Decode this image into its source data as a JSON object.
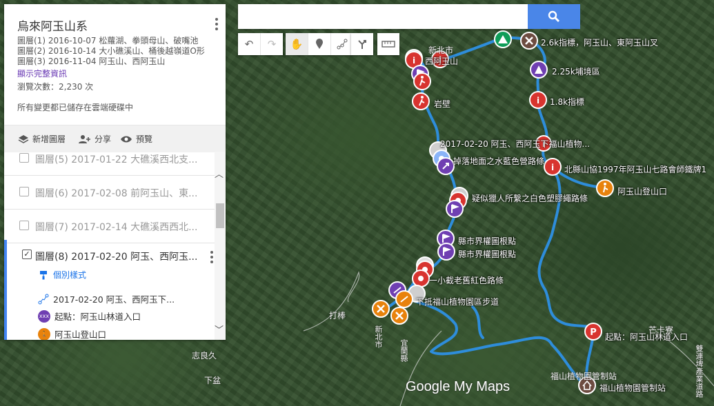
{
  "panel": {
    "title": "烏來阿玉山系",
    "desc_lines": [
      "圖層(1) 2016-10-07 松蘿湖、拳頭母山、破嘴池",
      "圖層(2) 2016-10-14 大小礁溪山、桶後越嶺道O形",
      "圖層(3) 2016-11-04 阿玉山、西阿玉山"
    ],
    "details_link": "顯示完整資訊",
    "views": "瀏覽次數：2,230 次",
    "saved": "所有變更都已儲存在雲端硬碟中",
    "toolbar": {
      "add_layer": "新增圖層",
      "share": "分享",
      "preview": "預覽"
    }
  },
  "layers": [
    {
      "label": "圖層(5) 2017-01-22 大礁溪西北支...",
      "checked": false
    },
    {
      "label": "圖層(6) 2017-02-08 前阿玉山、東...",
      "checked": false
    },
    {
      "label": "圖層(7) 2017-02-14 大礁溪西西北...",
      "checked": false
    }
  ],
  "active_layer": {
    "label": "圖層(8) 2017-02-20 阿玉、西阿玉...",
    "checked": true,
    "style_link": "個別樣式",
    "features": [
      {
        "text": "2017-02-20 阿玉、西阿玉下...",
        "icon": "route-icon"
      },
      {
        "text": "起點：阿玉山林道入口",
        "icon": "purple-marker",
        "color": "#6f3fb2"
      },
      {
        "text": "阿玉山登山口",
        "icon": "hiker-icon",
        "color": "#e8820c"
      }
    ]
  },
  "search": {
    "placeholder": ""
  },
  "tools": [
    "undo",
    "redo",
    "pan",
    "marker",
    "line",
    "route",
    "measure"
  ],
  "map_labels": [
    {
      "text": "2.6k指標，阿玉山、東阿玉山叉"
    },
    {
      "text": "2.25k埔境區"
    },
    {
      "text": "1.8k指標"
    },
    {
      "text": "西阿玉山"
    },
    {
      "text": "岩壁"
    },
    {
      "text": "2017-02-20 阿玉、西阿玉下福山植物..."
    },
    {
      "text": "掉落地面之水藍色營路條"
    },
    {
      "text": "北縣山協1997年阿玉山七路會師鐵牌1"
    },
    {
      "text": "阿玉山登山口"
    },
    {
      "text": "疑似獵人所繫之白色塑膠繩路條"
    },
    {
      "text": "縣市界權圖根點"
    },
    {
      "text": "縣市界權圖根點"
    },
    {
      "text": "一小截老舊紅色路條"
    },
    {
      "text": "下抵福山植物園區步道"
    },
    {
      "text": "起點：阿玉山林道入口"
    },
    {
      "text": "福山植物園管制站"
    }
  ],
  "place_labels": [
    {
      "text": "新北市"
    },
    {
      "text": "打棒"
    },
    {
      "text": "志良久"
    },
    {
      "text": "下盆"
    },
    {
      "text": "新北市"
    },
    {
      "text": "宜蘭縣"
    },
    {
      "text": "芒卡寮"
    },
    {
      "text": "福山植物園管制站"
    },
    {
      "text": "雙連埤產業道路"
    }
  ],
  "colors": {
    "route": "#2e8ddb",
    "red_pin": "#d8342f",
    "purple_pin": "#6f3fb2",
    "orange_pin": "#e8820c",
    "green_pin": "#0f9d58",
    "brown_pin": "#6d4c41",
    "search_button": "#4a86e8"
  },
  "attribution": "Google My Maps"
}
